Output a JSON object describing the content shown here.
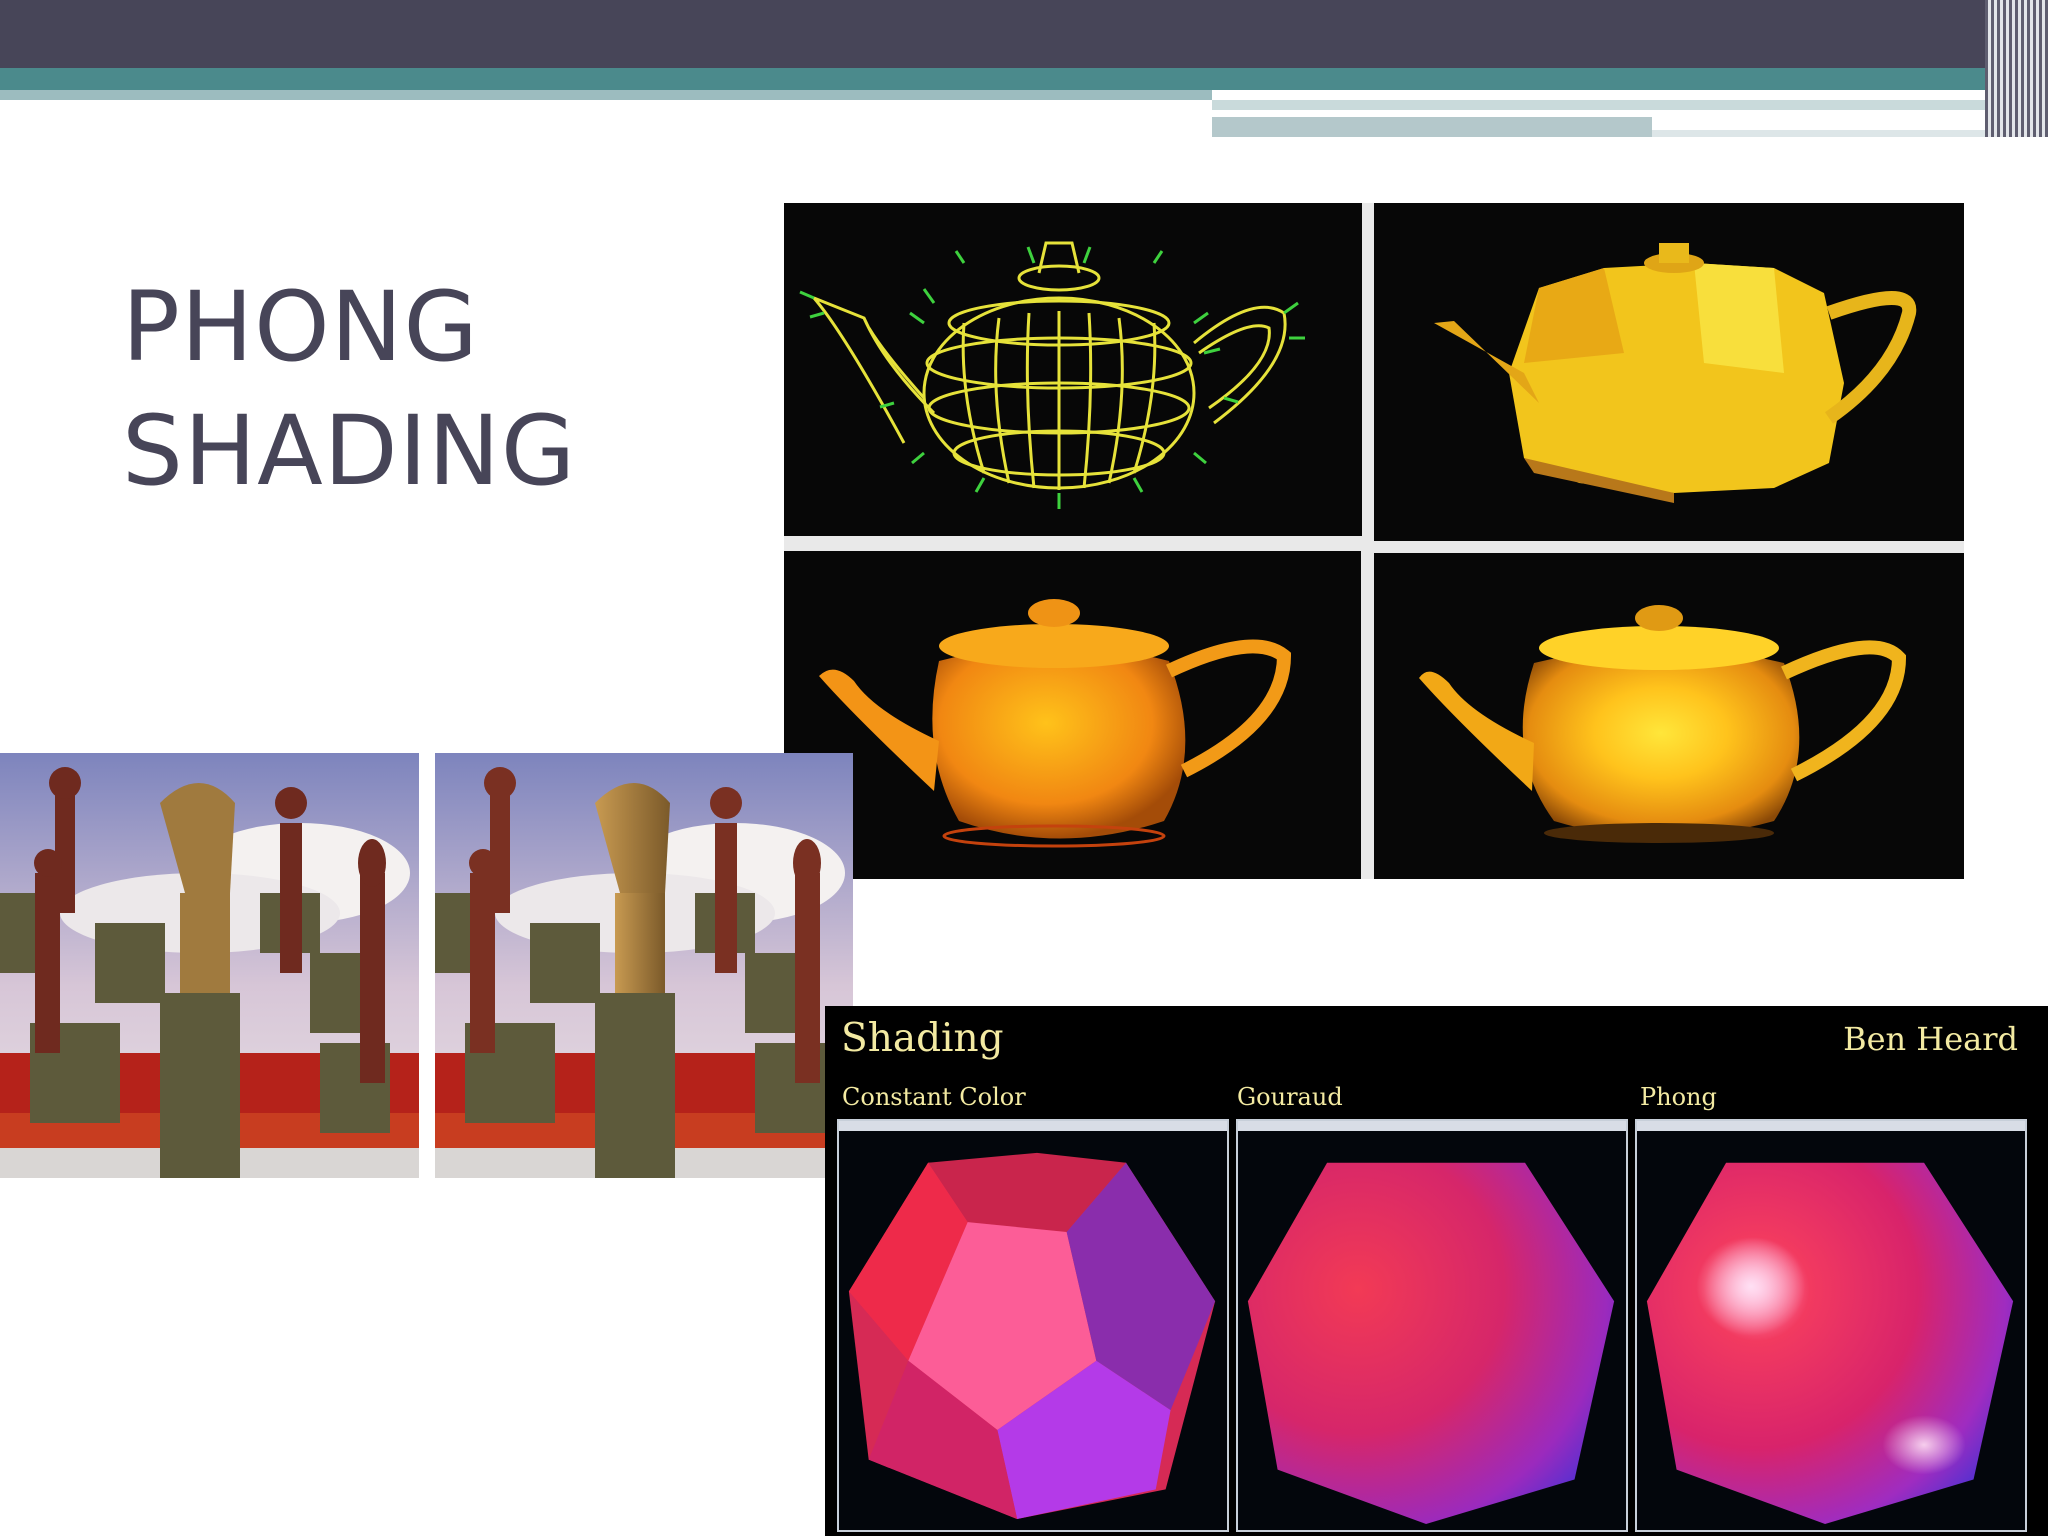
{
  "slide": {
    "title_line1": "PHONG",
    "title_line2": "SHADING"
  },
  "figures": {
    "teapots": {
      "panels": [
        "wireframe-with-normals",
        "flat-shaded",
        "gouraud-shaded",
        "phong-shaded"
      ]
    },
    "chess_scene": {
      "panels": [
        "gouraud-render",
        "phong-render"
      ]
    },
    "sphere_comparison": {
      "title": "Shading",
      "author": "Ben Heard",
      "labels": [
        "Constant Color",
        "Gouraud",
        "Phong"
      ]
    }
  },
  "colors": {
    "title_text": "#474558",
    "band_dark": "#474558",
    "band_teal": "#4b8a8c",
    "band_light": "#9cbcbf",
    "figure_caption_text": "#f3eaa2"
  }
}
